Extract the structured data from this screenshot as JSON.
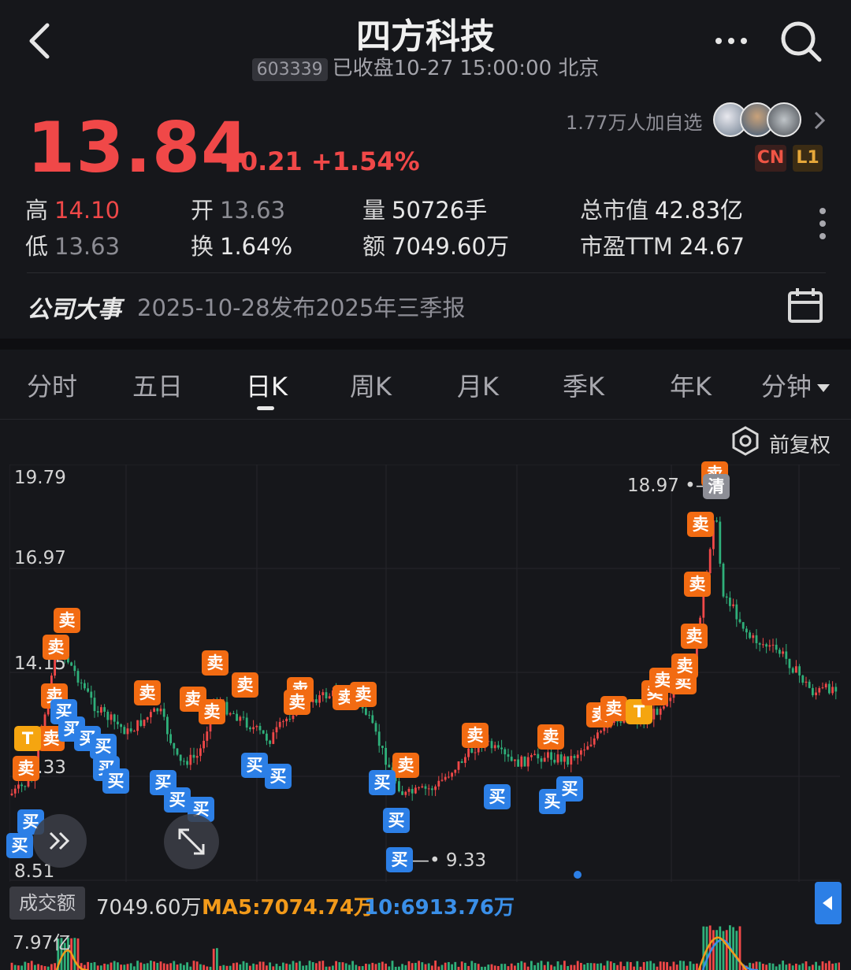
{
  "header": {
    "title": "四方科技",
    "code": "603339",
    "status": "已收盘10-27 15:00:00 北京"
  },
  "quote": {
    "price": "13.84",
    "change": "+0.21 +1.54%",
    "followers": "1.77万人加自选",
    "badge_cn": "CN",
    "badge_l1": "L1"
  },
  "stats": {
    "high_label": "高",
    "high": "14.10",
    "low_label": "低",
    "low": "13.63",
    "open_label": "开",
    "open": "13.63",
    "turnover_label": "换",
    "turnover": "1.64%",
    "volume_label": "量",
    "volume": "50726手",
    "amount_label": "额",
    "amount": "7049.60万",
    "mcap_label": "总市值",
    "mcap": "42.83亿",
    "pe_label": "市盈TTM",
    "pe": "24.67"
  },
  "event": {
    "title": "公司大事",
    "text": "2025-10-28发布2025年三季报"
  },
  "tabs": [
    "分时",
    "五日",
    "日K",
    "周K",
    "月K",
    "季K",
    "年K",
    "分钟"
  ],
  "active_tab": "日K",
  "adjust_label": "前复权",
  "chart_data": {
    "type": "candlestick",
    "y_labels": [
      "19.79",
      "16.97",
      "14.15",
      "11.33",
      "8.51"
    ],
    "ylim": [
      8.51,
      19.79
    ],
    "high_annotation": "18.97",
    "low_annotation": "9.33",
    "signal_labels": {
      "sell": "卖",
      "buy": "买",
      "t": "T",
      "clear": "清"
    }
  },
  "volume": {
    "label": "成交额",
    "amount": "7049.60万",
    "ma5": "MA5:7074.74万",
    "ma10": "10:6913.76万",
    "ymax": "7.97亿"
  },
  "colors": {
    "up": "#f04848",
    "down": "#2fb07a",
    "sell": "#f26b12",
    "buy": "#2c7fe6",
    "bg": "#16171b"
  },
  "icons": [
    "back-arrow-icon",
    "more-icon",
    "search-icon",
    "chevron-right-icon",
    "vertical-more-icon",
    "calendar-icon",
    "settings-hex-icon",
    "fast-forward-icon",
    "expand-icon",
    "caret-left-icon",
    "caret-down-icon"
  ]
}
